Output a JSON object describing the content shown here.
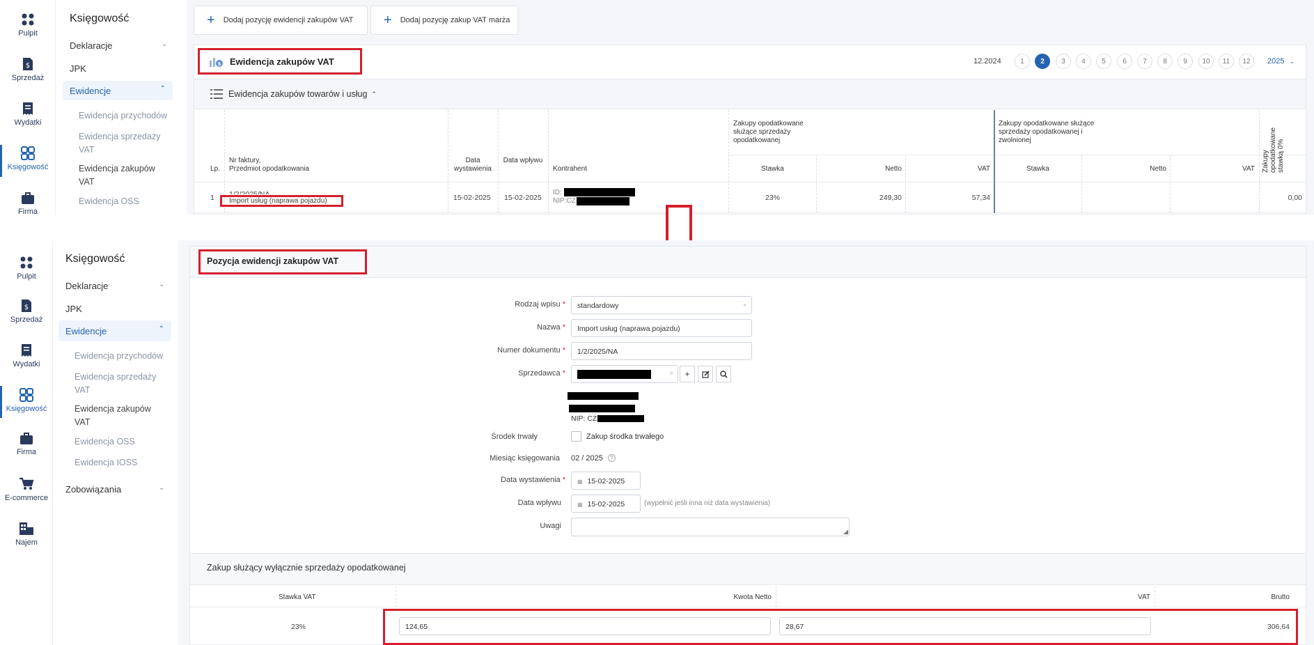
{
  "nav": [
    {
      "label": "Pulpit",
      "icon": "grid-icon"
    },
    {
      "label": "Sprzedaż",
      "icon": "invoice-dollar-icon"
    },
    {
      "label": "Wydatki",
      "icon": "receipt-icon"
    },
    {
      "label": "Księgowość",
      "icon": "apps-icon"
    },
    {
      "label": "Firma",
      "icon": "briefcase-icon"
    },
    {
      "label": "E-commerce",
      "icon": "cart-icon"
    },
    {
      "label": "Najem",
      "icon": "building-icon"
    }
  ],
  "top_nav_partial_label": "Firma",
  "menu": {
    "title": "Księgowość",
    "deklaracje": "Deklaracje",
    "jpk": "JPK",
    "ewidencje": "Ewidencje",
    "sub": [
      "Ewidencja przychodów",
      "Ewidencja sprzedaży VAT",
      "Ewidencja zakupów VAT",
      "Ewidencja OSS",
      "Ewidencja IOSS"
    ],
    "zobowiazania": "Zobowiązania"
  },
  "toolbar": {
    "add_purchase": "Dodaj pozycję ewidencji zakupów VAT",
    "add_margin": "Dodaj pozycję zakup VAT marża"
  },
  "register": {
    "title": "Ewidencja zakupów VAT",
    "period": "12.2024",
    "months": [
      "1",
      "2",
      "3",
      "4",
      "5",
      "6",
      "7",
      "8",
      "9",
      "10",
      "11",
      "12"
    ],
    "selected_month": "2",
    "year": "2025",
    "section": "Ewidencja zakupów towarów i usług",
    "group1": "Zakupy opodatkowane służące sprzedaży opodatkowanej",
    "group2": "Zakupy opodatkowane służące sprzedaży opodatkowanej i zwolnionej",
    "col_lp": "Lp.",
    "col_nr": "Nr faktury,",
    "col_nr2": "Przedmiot opodatkowania",
    "col_date_issue": "Data wystawienia",
    "col_date_in": "Data wpływu",
    "col_contractor": "Kontrahent",
    "col_stawka": "Stawka",
    "col_netto": "Netto",
    "col_vat": "VAT",
    "col_zero": "Zakupy opodatkowane stawką 0%",
    "row": {
      "lp": "1",
      "nr": "1/2/2025/NA",
      "subject": "Import usług (naprawa pojazdu)",
      "date_issue": "15-02-2025",
      "date_in": "15-02-2025",
      "id_label": "ID:",
      "nip_label": "NIP:CZ",
      "stawka": "23%",
      "netto": "249,30",
      "vat": "57,34",
      "zero": "0,00"
    }
  },
  "form": {
    "title": "Pozycja ewidencji zakupów VAT",
    "rodzaj_label": "Rodzaj wpisu",
    "rodzaj_value": "standardowy",
    "nazwa_label": "Nazwa",
    "nazwa_value": "Import usług (naprawa pojazdu)",
    "numer_label": "Numer dokumentu",
    "numer_value": "1/2/2025/NA",
    "sprzedawca_label": "Sprzedawca",
    "nip_prefix": "NIP: CZ",
    "srodek_label": "Środek trwały",
    "srodek_checkbox": "Zakup środka trwałego",
    "miesiac_label": "Miesiąc księgowania",
    "miesiac_value": "02 / 2025",
    "data_wyst_label": "Data wystawienia",
    "data_wyst_value": "15-02-2025",
    "data_wpl_label": "Data wpływu",
    "data_wpl_value": "15-02-2025",
    "data_wpl_hint": "(wypełnić jeśli inna niż data wystawienia)",
    "uwagi_label": "Uwagi"
  },
  "summary": {
    "title": "Zakup służący wyłącznie sprzedaży opodatkowanej",
    "col_stawka": "Stawka VAT",
    "col_netto": "Kwota Netto",
    "col_vat": "VAT",
    "col_brutto": "Brutto",
    "stawka": "23%",
    "netto": "124,65",
    "vat": "28,67",
    "brutto": "306,64"
  }
}
